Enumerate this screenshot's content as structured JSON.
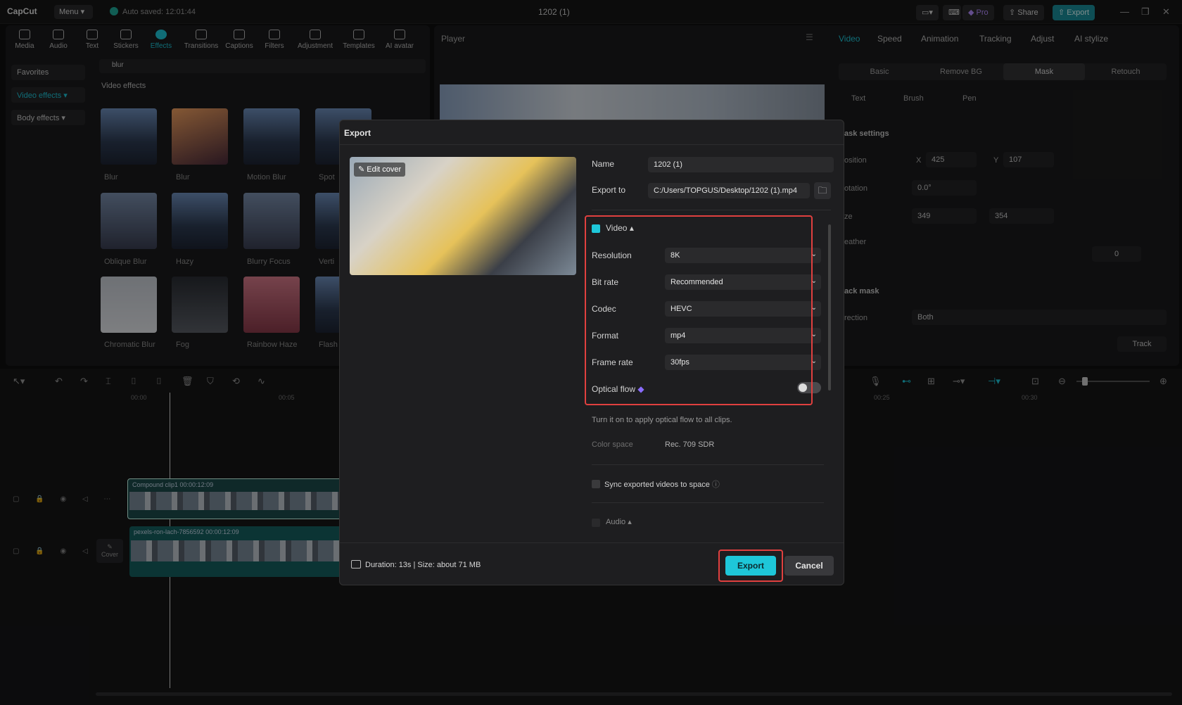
{
  "app": {
    "logo": "CapCut",
    "menu_label": "Menu",
    "autosave": "Auto saved: 12:01:44",
    "doc_title": "1202 (1)",
    "pro_label": "Pro",
    "share_label": "Share",
    "export_label": "Export"
  },
  "toolbar": {
    "items": [
      "Media",
      "Audio",
      "Text",
      "Stickers",
      "Effects",
      "Transitions",
      "Captions",
      "Filters",
      "Adjustment",
      "Templates",
      "AI avatar"
    ],
    "active": "Effects"
  },
  "effects_panel": {
    "categories": [
      "Favorites",
      "Video effects",
      "Body effects"
    ],
    "active_category": "Video effects",
    "search_value": "blur",
    "section_title": "Video effects",
    "thumbs": [
      "Blur",
      "Blur",
      "Motion Blur",
      "Spot",
      "Oblique Blur",
      "Hazy",
      "Blurry Focus",
      "Verti",
      "Chromatic Blur",
      "Fog",
      "Rainbow Haze",
      "Flash"
    ]
  },
  "player": {
    "title": "Player"
  },
  "right_panel": {
    "tabs": [
      "Video",
      "Speed",
      "Animation",
      "Tracking",
      "Adjust",
      "AI stylize"
    ],
    "active_tab": "Video",
    "subtabs": [
      "Basic",
      "Remove BG",
      "Mask",
      "Retouch"
    ],
    "active_subtab": "Mask",
    "mask_types": [
      "Text",
      "Brush",
      "Pen"
    ],
    "mask_settings": "ask settings",
    "position_label": "osition",
    "x_label": "X",
    "x_value": "425",
    "y_label": "Y",
    "y_value": "107",
    "rotation_label": "otation",
    "rotation_value": "0.0°",
    "size_label": "ze",
    "width_value": "349",
    "height_value": "354",
    "feather_label": "eather",
    "feather_value": "0",
    "track_mask": "ack mask",
    "direction_label": "rection",
    "direction_value": "Both",
    "track_button": "Track"
  },
  "timeline": {
    "ruler": [
      "00:00",
      "00:05",
      "00:25",
      "00:30"
    ],
    "clip1_label": "Compound clip1   00:00:12:09",
    "clip2_label": "pexels-ron-lach-7856592   00:00:12:09",
    "cover_label": "Cover"
  },
  "export_dialog": {
    "title": "Export",
    "edit_cover": "Edit cover",
    "name_label": "Name",
    "name_value": "1202 (1)",
    "export_to_label": "Export to",
    "export_to_value": "C:/Users/TOPGUS/Desktop/1202 (1).mp4",
    "video_section": "Video",
    "resolution_label": "Resolution",
    "resolution_value": "8K",
    "bitrate_label": "Bit rate",
    "bitrate_value": "Recommended",
    "codec_label": "Codec",
    "codec_value": "HEVC",
    "format_label": "Format",
    "format_value": "mp4",
    "framerate_label": "Frame rate",
    "framerate_value": "30fps",
    "optical_flow_label": "Optical flow",
    "optical_flow_hint": "Turn it on to apply optical flow to all clips.",
    "color_space_label": "Color space",
    "color_space_value": "Rec. 709 SDR",
    "sync_label": "Sync exported videos to space",
    "audio_section": "Audio",
    "footer_info": "Duration: 13s | Size: about 71 MB",
    "export_button": "Export",
    "cancel_button": "Cancel"
  },
  "colors": {
    "accent": "#1ec7d9",
    "highlight": "#e0403f"
  }
}
